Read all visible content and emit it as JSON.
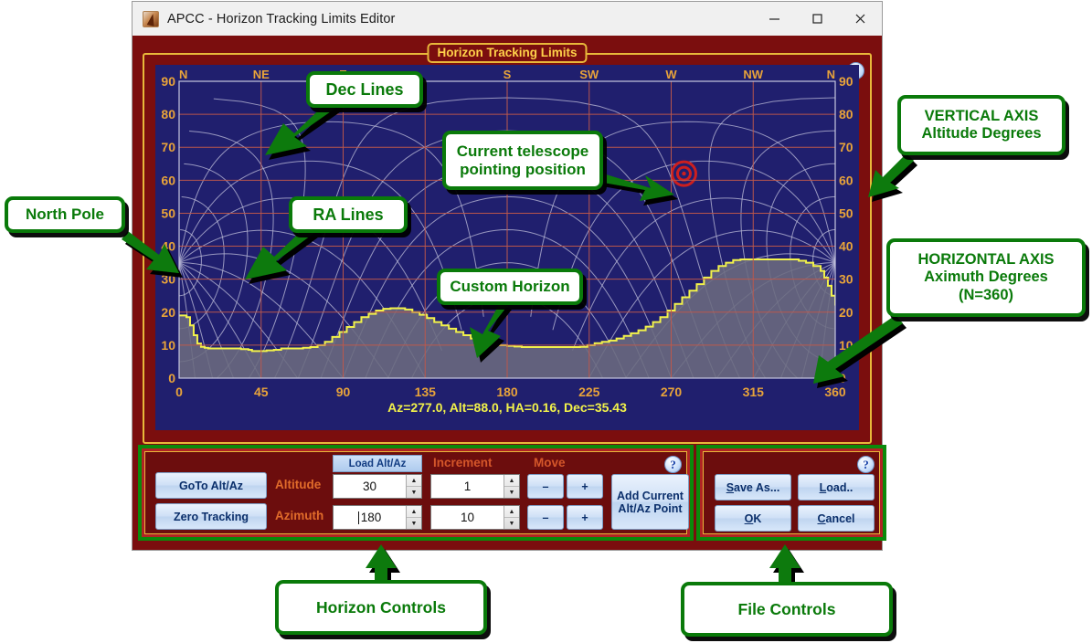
{
  "window": {
    "title": "APCC - Horizon Tracking Limits Editor",
    "icon": "apcc-app-icon",
    "buttons": {
      "minimize": "–",
      "maximize": "□",
      "close": "✕"
    }
  },
  "groupbox": {
    "legend": "Horizon Tracking Limits",
    "help": "?"
  },
  "status": {
    "text": "Az=277.0, Alt=88.0, HA=0.16, Dec=35.43"
  },
  "chart_data": {
    "type": "area",
    "title": "Horizon Tracking Limits",
    "xlabel": "Azimuth Degrees",
    "ylabel": "Altitude Degrees",
    "xlim": [
      0,
      360
    ],
    "ylim": [
      0,
      90
    ],
    "xticks": [
      0,
      45,
      90,
      135,
      180,
      225,
      270,
      315,
      360
    ],
    "yticks": [
      0,
      10,
      20,
      30,
      40,
      50,
      60,
      70,
      80,
      90
    ],
    "compass_labels": [
      {
        "label": "N",
        "az": 0
      },
      {
        "label": "NE",
        "az": 45
      },
      {
        "label": "E",
        "az": 90
      },
      {
        "label": "S",
        "az": 180
      },
      {
        "label": "SW",
        "az": 225
      },
      {
        "label": "W",
        "az": 270
      },
      {
        "label": "NW",
        "az": 315
      },
      {
        "label": "N",
        "az": 360
      }
    ],
    "grid": true,
    "legend": "none",
    "series": [
      {
        "name": "Custom Horizon",
        "color": "#f2f24a",
        "fill": "#6b6b80",
        "x": [
          0,
          2,
          4,
          6,
          8,
          10,
          12,
          14,
          16,
          18,
          22,
          26,
          30,
          34,
          38,
          40,
          44,
          48,
          52,
          56,
          60,
          64,
          68,
          72,
          76,
          80,
          84,
          88,
          92,
          96,
          100,
          104,
          108,
          112,
          116,
          120,
          124,
          128,
          132,
          136,
          140,
          144,
          148,
          152,
          156,
          160,
          164,
          168,
          172,
          176,
          180,
          184,
          188,
          192,
          196,
          200,
          204,
          208,
          212,
          216,
          220,
          224,
          228,
          232,
          236,
          240,
          244,
          248,
          252,
          256,
          260,
          264,
          268,
          272,
          276,
          280,
          284,
          288,
          292,
          296,
          300,
          304,
          308,
          312,
          316,
          320,
          324,
          328,
          332,
          336,
          340,
          344,
          348,
          352,
          354,
          356,
          358,
          360
        ],
        "y": [
          19,
          19,
          18.5,
          16,
          13,
          10.5,
          9.5,
          9.2,
          9,
          9,
          9,
          9,
          9,
          8.8,
          8.6,
          8.2,
          8.2,
          8.4,
          8.6,
          9,
          9,
          9,
          9.2,
          9.4,
          10,
          11,
          12.5,
          14,
          15.5,
          17,
          18.5,
          19.5,
          20.5,
          21,
          21.2,
          21.2,
          20.8,
          20,
          19.2,
          18.2,
          17,
          16,
          15,
          14,
          13,
          12,
          11.2,
          10.6,
          10.2,
          10,
          9.8,
          9.6,
          9.4,
          9.4,
          9.4,
          9.4,
          9.4,
          9.4,
          9.4,
          9.4,
          9.5,
          10,
          10.6,
          11,
          11.4,
          12,
          12.8,
          13.6,
          14.5,
          15.6,
          17,
          18.5,
          20.5,
          22.5,
          24.5,
          26.5,
          28.5,
          30.5,
          32.5,
          34,
          35,
          35.8,
          36,
          36,
          36,
          36,
          36,
          36,
          36,
          36,
          35.6,
          35,
          34,
          32.5,
          30.5,
          28,
          25,
          22,
          19
        ]
      }
    ],
    "telescope_marker": {
      "az": 277.0,
      "alt": 88.0,
      "shape": "bullseye",
      "color": "#cc1f1f"
    },
    "north_pole": {
      "az": 0,
      "alt": 35,
      "label": "North Pole"
    },
    "overlays": [
      {
        "name": "Dec Lines",
        "color": "#b8b8d8"
      },
      {
        "name": "RA Lines",
        "color": "#b8b8d8"
      }
    ],
    "colors": {
      "plot_background": "#201f6e",
      "axis_text": "#e8a33a",
      "gridline": "#c0584a",
      "horizon_line": "#f2f24a",
      "horizon_fill": "#6b6b80"
    }
  },
  "horizon_controls": {
    "help": "?",
    "goto_button": "GoTo Alt/Az",
    "zero_button": "Zero Tracking",
    "load_altaz_button": "Load Alt/Az",
    "increment_label": "Increment",
    "move_label": "Move",
    "rows": [
      {
        "label": "Altitude",
        "value": "30",
        "increment": "1",
        "minus": "–",
        "plus": "+",
        "caret": false
      },
      {
        "label": "Azimuth",
        "value": "180",
        "increment": "10",
        "minus": "–",
        "plus": "+",
        "caret": true
      }
    ],
    "add_point_button_line1": "Add Current",
    "add_point_button_line2": "Alt/Az Point"
  },
  "file_controls": {
    "help": "?",
    "buttons": [
      {
        "id": "save-as",
        "accel": "S",
        "rest": "ave As..."
      },
      {
        "id": "load",
        "accel": "L",
        "rest": "oad.."
      },
      {
        "id": "ok",
        "accel": "O",
        "rest": "K"
      },
      {
        "id": "cancel",
        "accel": "C",
        "rest": "ancel"
      }
    ]
  },
  "annotations": [
    {
      "id": "dec-lines",
      "lines": [
        "Dec Lines"
      ]
    },
    {
      "id": "current-pointing",
      "lines": [
        "Current telescope",
        "pointing position"
      ]
    },
    {
      "id": "ra-lines",
      "lines": [
        "RA Lines"
      ]
    },
    {
      "id": "custom-horizon",
      "lines": [
        "Custom Horizon"
      ]
    },
    {
      "id": "north-pole",
      "lines": [
        "North Pole"
      ]
    },
    {
      "id": "vertical-axis",
      "lines": [
        "VERTICAL AXIS",
        "Altitude Degrees"
      ]
    },
    {
      "id": "horizontal-axis",
      "lines": [
        "HORIZONTAL AXIS",
        "Aximuth Degrees",
        "(N=360)"
      ]
    },
    {
      "id": "horizon-controls",
      "lines": [
        "Horizon Controls"
      ]
    },
    {
      "id": "file-controls",
      "lines": [
        "File Controls"
      ]
    }
  ]
}
